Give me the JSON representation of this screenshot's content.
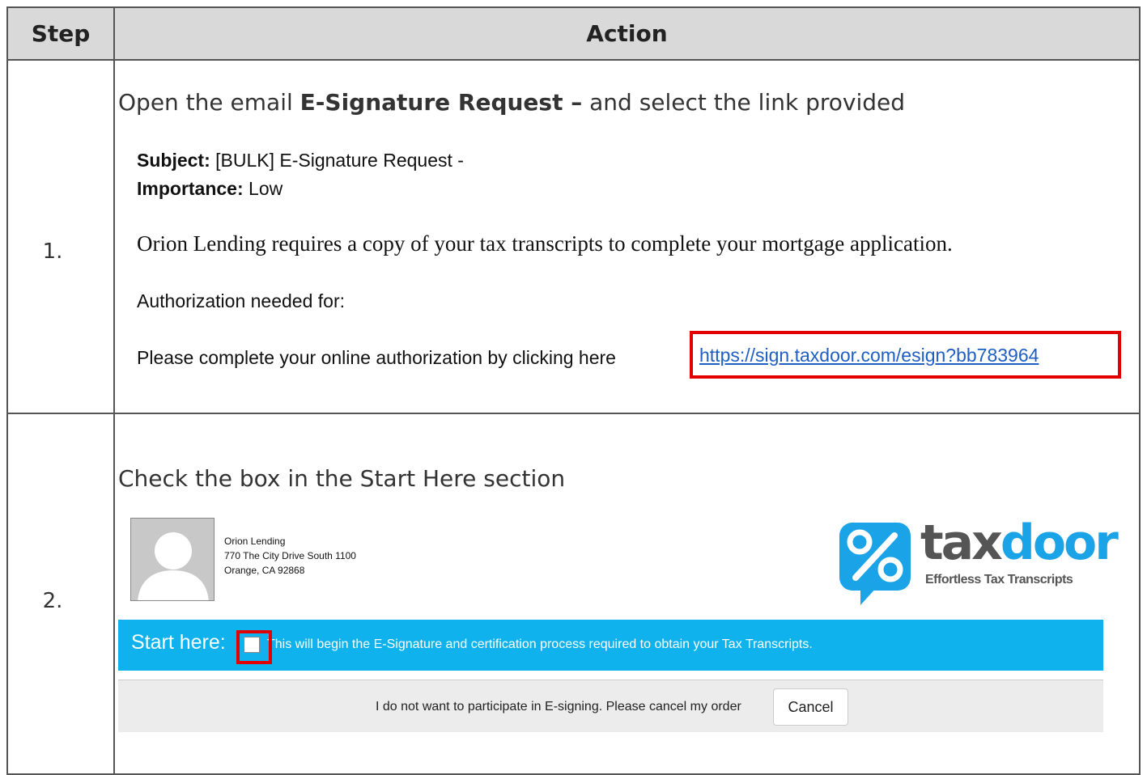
{
  "table": {
    "header_step": "Step",
    "header_action": "Action"
  },
  "step1": {
    "number": "1.",
    "instruction_prefix": "Open the email ",
    "instruction_bold": "E-Signature Request –",
    "instruction_suffix": " and select the link provided",
    "email": {
      "subject_label": "Subject:",
      "subject_value": " [BULK] E-Signature Request -",
      "importance_label": "Importance:",
      "importance_value": " Low",
      "body_line": "Orion Lending requires a copy of your tax transcripts to complete your mortgage application.",
      "authorization_line": "Authorization needed for:",
      "complete_prefix": "Please complete your online authorization by clicking here",
      "link_text": "https://sign.taxdoor.com/esign?bb783964"
    }
  },
  "step2": {
    "number": "2.",
    "instruction": "Check the box in the Start Here section",
    "lender": {
      "name": "Orion Lending",
      "address_line1": "770 The City Drive South 1100",
      "address_line2": "Orange, CA 92868"
    },
    "logo": {
      "wordmark_tax": "tax",
      "wordmark_door": "door",
      "tagline": "Effortless Tax Transcripts"
    },
    "start_bar": {
      "label": "Start here:",
      "description": "This will begin the E-Signature and certification process required to obtain your Tax Transcripts."
    },
    "cancel_bar": {
      "text": "I do not want to participate in E-signing. Please cancel my order",
      "button_label": "Cancel"
    }
  },
  "colors": {
    "highlight_red": "#e20000",
    "start_bar_blue": "#0fb2ec",
    "logo_blue": "#1aa3e6",
    "link_blue": "#1f5fc4"
  }
}
